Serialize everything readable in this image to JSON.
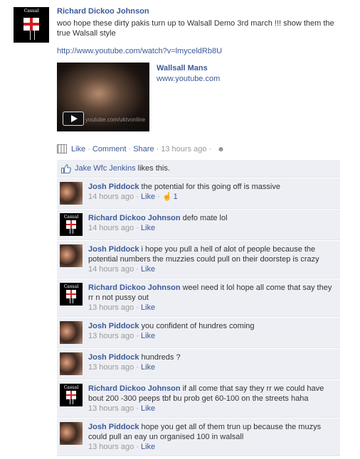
{
  "post": {
    "author": "Richard Dickoo Johnson",
    "avatar_text": "Casual",
    "text": "woo hope these dirty pakis turn up to Walsall Demo 3rd march !!! show them the true Walsall style",
    "url": "http://www.youtube.com/watch?v=lmyceldRb8U",
    "share_title": "Wallsall Mans",
    "share_domain": "www.youtube.com",
    "video_watermark": "youtube.com/uktvonline",
    "actions": {
      "like": "Like",
      "comment": "Comment",
      "share": "Share",
      "time": "13 hours ago"
    }
  },
  "likes_text_name": "Jake Wfc Jenkins",
  "likes_text_suffix": "likes this.",
  "comments": [
    {
      "author": "Josh Piddock",
      "text": "the potential for this going off is massive",
      "time": "14 hours ago",
      "like": "Like",
      "like_count": "1",
      "avatar": "josh"
    },
    {
      "author": "Richard Dickoo Johnson",
      "text": "defo mate lol",
      "time": "14 hours ago",
      "like": "Like",
      "avatar": "casual"
    },
    {
      "author": "Josh Piddock",
      "text": "i hope you pull a hell of alot of people because the potential numbers the muzzies could pull on their doorstep is crazy",
      "time": "14 hours ago",
      "like": "Like",
      "avatar": "josh"
    },
    {
      "author": "Richard Dickoo Johnson",
      "text": "weel need it lol hope all come that say they rr n not pussy out",
      "time": "13 hours ago",
      "like": "Like",
      "avatar": "casual"
    },
    {
      "author": "Josh Piddock",
      "text": "you confident of hundres coming",
      "time": "13 hours ago",
      "like": "Like",
      "avatar": "josh"
    },
    {
      "author": "Josh Piddock",
      "text": "hundreds ?",
      "time": "13 hours ago",
      "like": "Like",
      "avatar": "josh"
    },
    {
      "author": "Richard Dickoo Johnson",
      "text": "if all come that say they rr we could have bout 200 -300 peeps tbf bu prob get 60-100 on the streets haha",
      "time": "13 hours ago",
      "like": "Like",
      "avatar": "casual"
    },
    {
      "author": "Josh Piddock",
      "text": "hope you get all of them trun up because the muzys could pull an eay un organised 100 in walsall",
      "time": "13 hours ago",
      "like": "Like",
      "avatar": "josh"
    }
  ],
  "colors": {
    "link": "#3b5998",
    "feedback_bg": "#edeff4",
    "flag_red": "#d21f26"
  }
}
